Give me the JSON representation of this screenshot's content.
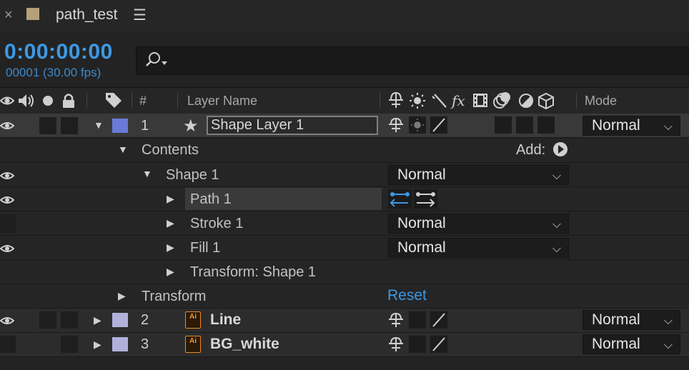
{
  "tab": {
    "title": "path_test",
    "close": "×",
    "menu": "☰"
  },
  "time": {
    "timecode": "0:00:00:00",
    "frames": "00001 (30.00 fps)"
  },
  "header": {
    "num": "#",
    "layer_name": "Layer Name",
    "mode": "Mode"
  },
  "layers": [
    {
      "num": "1",
      "name": "Shape Layer 1",
      "color": "#6a7ad8",
      "mode": "Normal"
    },
    {
      "num": "2",
      "name": "Line",
      "color": "#b1b1dc",
      "mode": "Normal"
    },
    {
      "num": "3",
      "name": "BG_white",
      "color": "#b1b1dc",
      "mode": "Normal"
    }
  ],
  "contents": {
    "label": "Contents",
    "add": "Add:"
  },
  "shape": {
    "label": "Shape 1",
    "blend": "Normal"
  },
  "path": {
    "label": "Path 1"
  },
  "stroke": {
    "label": "Stroke 1",
    "blend": "Normal"
  },
  "fill": {
    "label": "Fill 1",
    "blend": "Normal"
  },
  "shape_transform": {
    "label": "Transform: Shape 1"
  },
  "transform": {
    "label": "Transform",
    "reset": "Reset"
  },
  "ai_badge": {
    "top": "Ai",
    "bottom": "AI"
  },
  "colors": {
    "accent": "#3c99e6",
    "selected_path_bg": "#3a3a3a"
  }
}
